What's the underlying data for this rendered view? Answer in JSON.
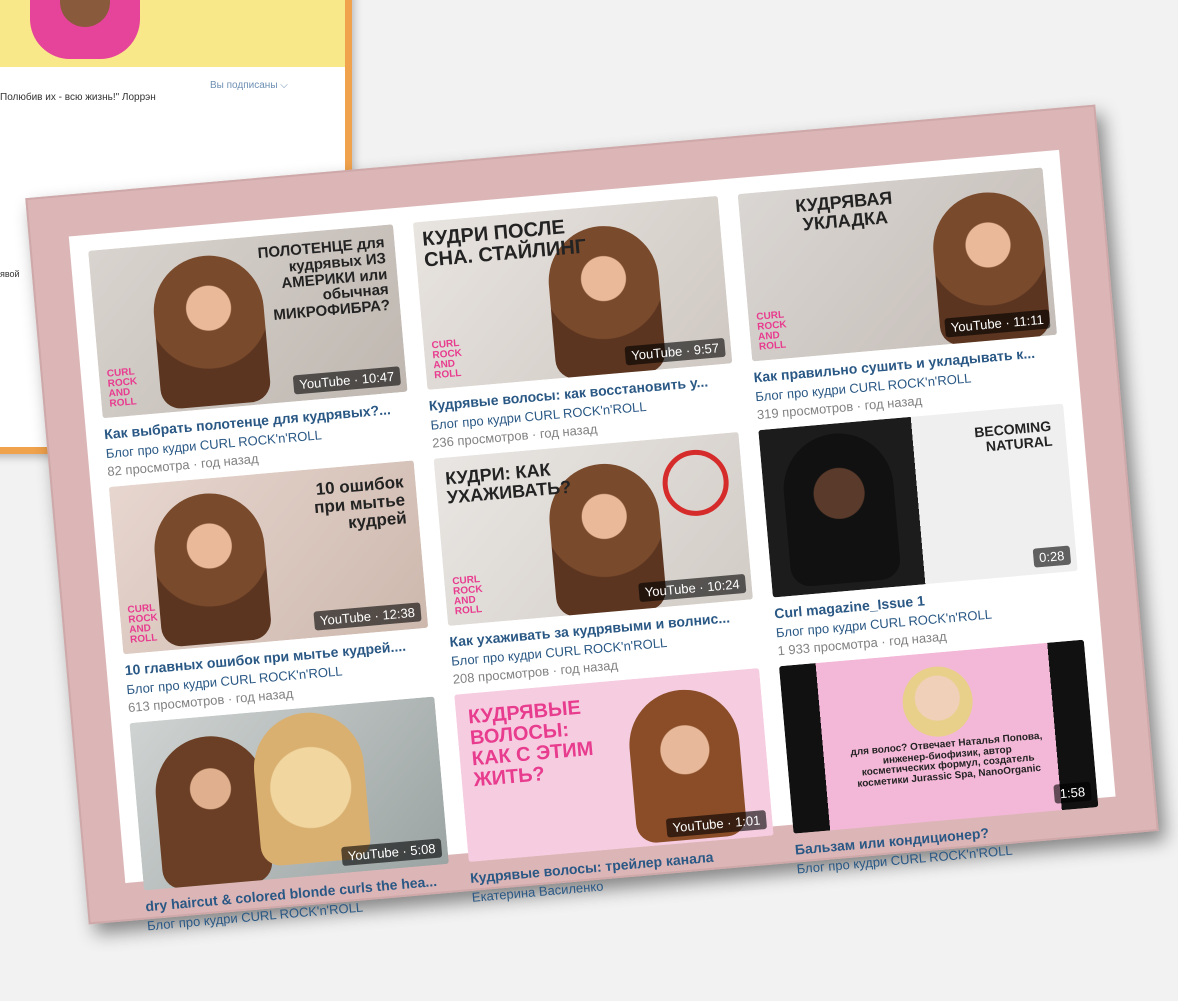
{
  "background_window": {
    "quote": "Полюбив их - всю жизнь!\" Лоррэн",
    "subscribed": "Вы подписаны ⌵",
    "side_text": "явой"
  },
  "cards": [
    {
      "thumb_text": "ПОЛОТЕНЦЕ для кудрявых ИЗ АМЕРИКИ или обычная МИКРОФИБРА?",
      "badge": "YouTube · 10:47",
      "logo": "CURL ROCK AND ROLL",
      "title": "Как выбрать полотенце для кудрявых?...",
      "channel": "Блог про кудри CURL ROCK'n'ROLL",
      "meta": "82 просмотра · год назад"
    },
    {
      "thumb_text": "КУДРИ ПОСЛЕ СНА. СТАЙЛИНГ",
      "badge": "YouTube · 9:57",
      "logo": "CURL ROCK AND ROLL",
      "title": "Кудрявые волосы: как восстановить у...",
      "channel": "Блог про кудри CURL ROCK'n'ROLL",
      "meta": "236 просмотров · год назад"
    },
    {
      "thumb_text": "КУДРЯВАЯ УКЛАДКА",
      "badge": "YouTube · 11:11",
      "logo": "CURL ROCK AND ROLL",
      "title": "Как правильно сушить и укладывать к...",
      "channel": "Блог про кудри CURL ROCK'n'ROLL",
      "meta": "319 просмотров · год назад"
    },
    {
      "thumb_text": "10 ошибок при мытье кудрей",
      "badge": "YouTube · 12:38",
      "logo": "CURL ROCK AND ROLL",
      "title": "10 главных ошибок при мытье кудрей....",
      "channel": "Блог про кудри CURL ROCK'n'ROLL",
      "meta": "613 просмотров · год назад"
    },
    {
      "thumb_text": "КУДРИ: КАК УХАЖИВАТЬ?",
      "badge": "YouTube · 10:24",
      "logo": "CURL ROCK AND ROLL",
      "title": "Как ухаживать за кудрявыми и волнис...",
      "channel": "Блог про кудри CURL ROCK'n'ROLL",
      "meta": "208 просмотров · год назад"
    },
    {
      "thumb_text": "BECOMING NATURAL",
      "badge": "0:28",
      "logo": "",
      "title": "Curl magazine_Issue 1",
      "channel": "Блог про кудри CURL ROCK'n'ROLL",
      "meta": "1 933 просмотра · год назад"
    },
    {
      "thumb_text": "",
      "badge": "YouTube · 5:08",
      "logo": "",
      "title": "dry haircut & colored blonde curls the hea...",
      "channel": "Блог про кудри CURL ROCK'n'ROLL",
      "meta": ""
    },
    {
      "thumb_text": "КУДРЯВЫЕ ВОЛОСЫ: КАК С ЭТИМ ЖИТЬ?",
      "badge": "YouTube · 1:01",
      "logo": "",
      "title": "Кудрявые волосы: трейлер канала",
      "channel": "Екатерина Василенко",
      "meta": ""
    },
    {
      "thumb_text": "для волос? Отвечает Наталья Попова, инженер-биофизик, автор косметических формул, создатель косметики Jurassic Spa, NanoOrganic",
      "badge": "1:58",
      "logo": "",
      "title": "Бальзам или кондиционер?",
      "channel": "Блог про кудри CURL ROCK'n'ROLL",
      "meta": ""
    }
  ],
  "colors": {
    "frame": "#dcb6b7",
    "link": "#2a5885",
    "meta": "#828282",
    "accent_pink": "#e83c8f"
  }
}
